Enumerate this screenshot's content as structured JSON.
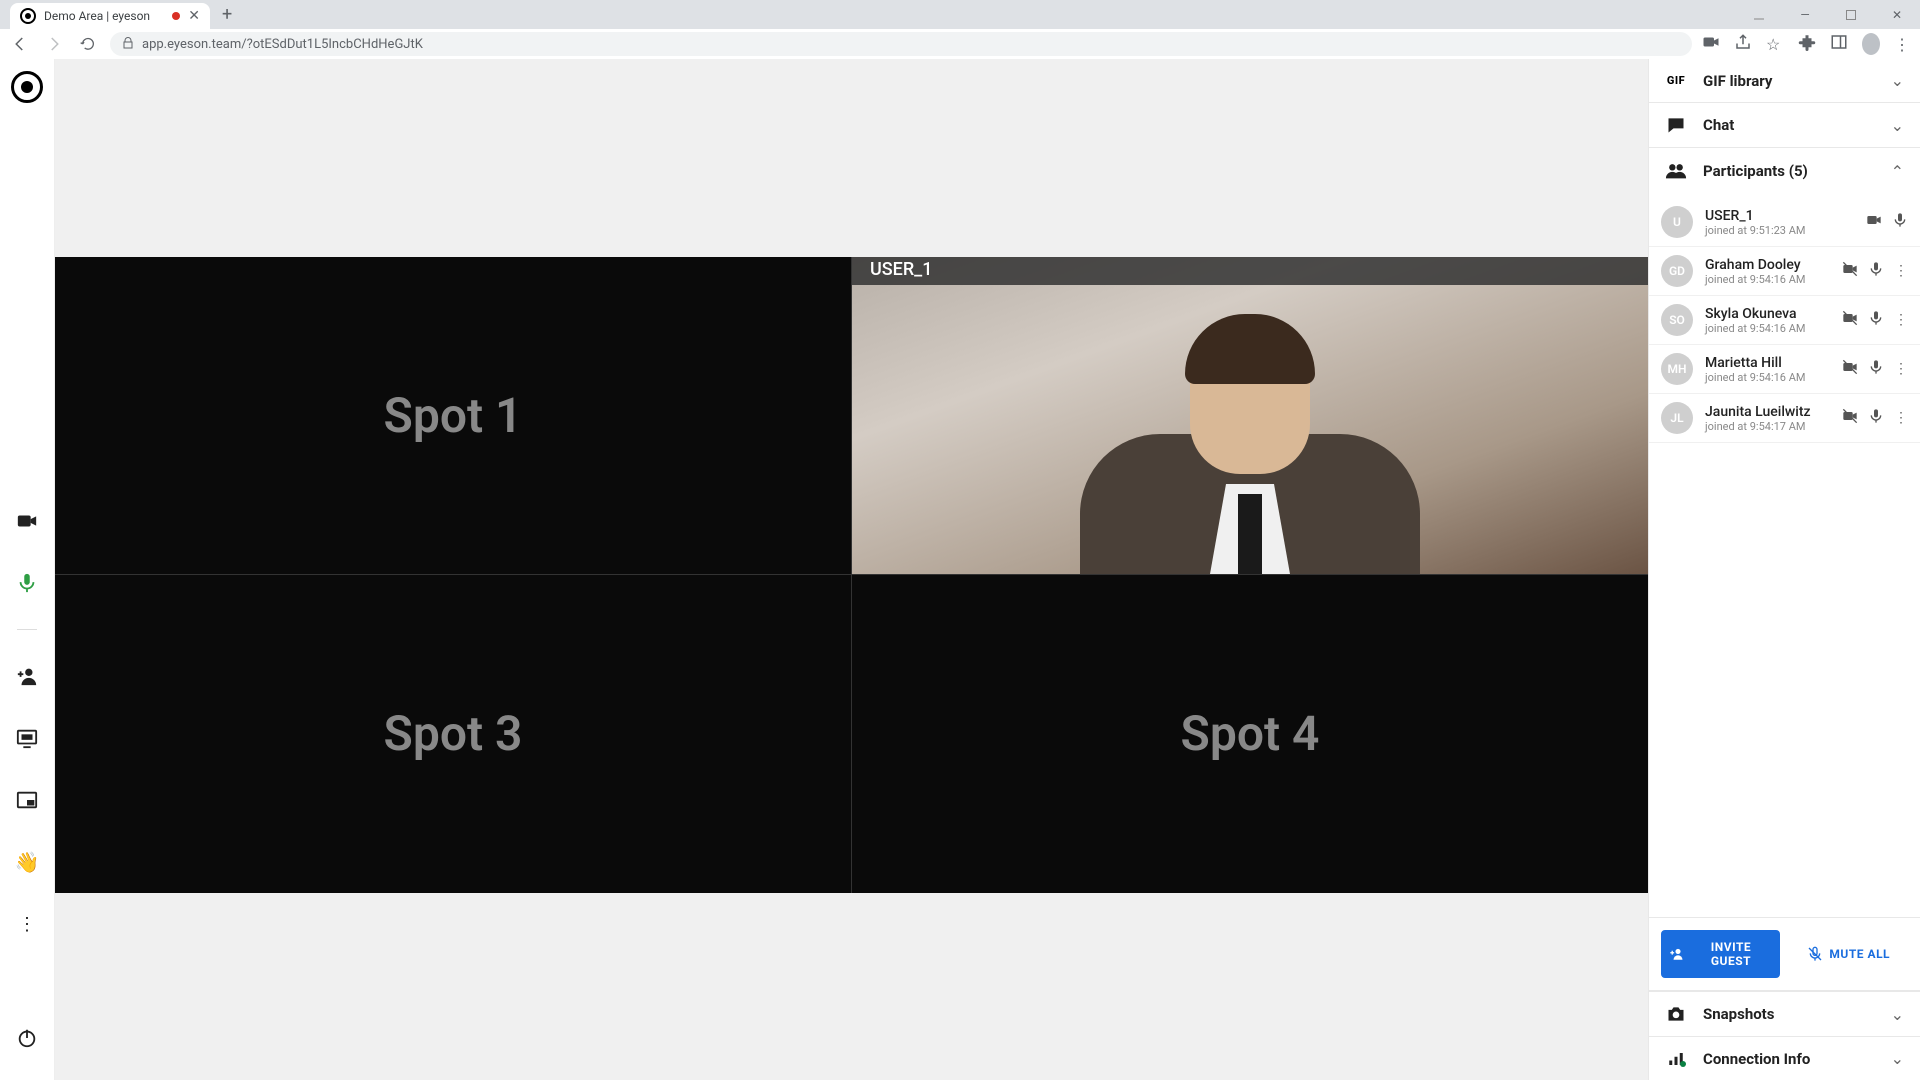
{
  "browser": {
    "tab_title": "Demo Area | eyeson",
    "url": "app.eyeson.team/?otESdDut1L5IncbCHdHeGJtK"
  },
  "video": {
    "spot1": "Spot 1",
    "spot3": "Spot 3",
    "spot4": "Spot 4",
    "user_label": "USER_1"
  },
  "panels": {
    "gif": "GIF library",
    "chat": "Chat",
    "participants_prefix": "Participants",
    "participants_count": "(5)",
    "snapshots": "Snapshots",
    "connection": "Connection Info"
  },
  "participants": [
    {
      "initials": "U",
      "avatar_color": "#cfcfcf",
      "name": "USER_1",
      "joined": "joined at 9:51:23 AM",
      "cam_on": true,
      "has_more": false
    },
    {
      "initials": "GD",
      "avatar_color": "#cfcfcf",
      "name": "Graham Dooley",
      "joined": "joined at 9:54:16 AM",
      "cam_on": false,
      "has_more": true
    },
    {
      "initials": "SO",
      "avatar_color": "#cfcfcf",
      "name": "Skyla Okuneva",
      "joined": "joined at 9:54:16 AM",
      "cam_on": false,
      "has_more": true
    },
    {
      "initials": "MH",
      "avatar_color": "#cfcfcf",
      "name": "Marietta Hill",
      "joined": "joined at 9:54:16 AM",
      "cam_on": false,
      "has_more": true
    },
    {
      "initials": "JL",
      "avatar_color": "#cfcfcf",
      "name": "Jaunita Lueilwitz",
      "joined": "joined at 9:54:17 AM",
      "cam_on": false,
      "has_more": true
    }
  ],
  "actions": {
    "invite": "INVITE GUEST",
    "mute_all": "MUTE ALL"
  }
}
